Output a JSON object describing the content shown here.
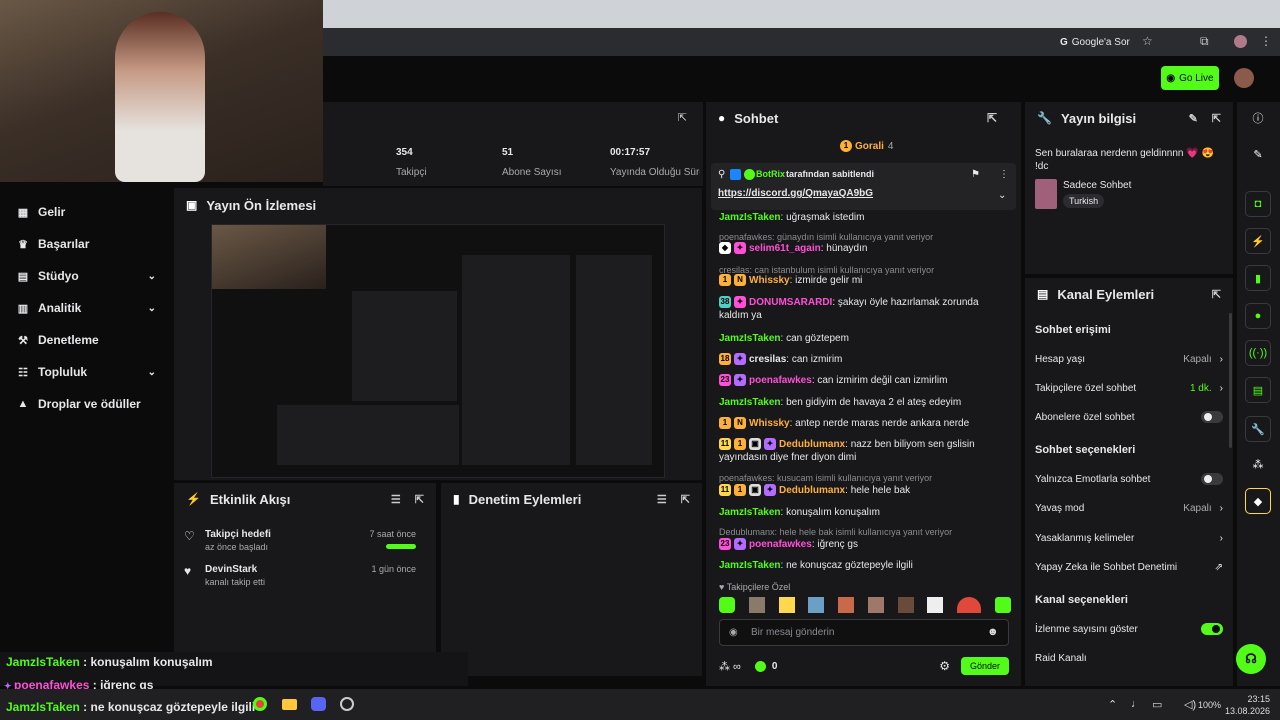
{
  "browser": {
    "google_ask": "Google'a Sor",
    "star_icon": "star-icon"
  },
  "header": {
    "go_live": "Go Live"
  },
  "stats": [
    {
      "value": "354",
      "label": "Takipçi"
    },
    {
      "value": "51",
      "label": "Abone Sayısı"
    },
    {
      "value": "00:17:57",
      "label": "Yayında Olduğu Süre"
    }
  ],
  "sidebar": {
    "items": [
      {
        "label": "Gelir",
        "icon": "dollar-icon",
        "chevron": false
      },
      {
        "label": "Başarılar",
        "icon": "trophy-icon",
        "chevron": false
      },
      {
        "label": "Stüdyo",
        "icon": "studio-icon",
        "chevron": true
      },
      {
        "label": "Analitik",
        "icon": "chart-icon",
        "chevron": true
      },
      {
        "label": "Denetleme",
        "icon": "hammer-icon",
        "chevron": false
      },
      {
        "label": "Topluluk",
        "icon": "people-icon",
        "chevron": true
      },
      {
        "label": "Droplar ve ödüller",
        "icon": "gift-icon",
        "chevron": false
      }
    ]
  },
  "preview": {
    "title": "Yayın Ön İzlemesi"
  },
  "activity": {
    "title": "Etkinlik Akışı",
    "items": [
      {
        "title": "Takipçi hedefi",
        "sub": "az önce başladı",
        "time": "7 saat önce"
      },
      {
        "title": "DevinStark",
        "sub": "kanalı takip etti",
        "time": "1 gün önce"
      }
    ]
  },
  "mod_actions": {
    "title": "Denetim Eylemleri"
  },
  "chat": {
    "title": "Sohbet",
    "gifter": "Gorali",
    "gifter_count": "4",
    "pinned_by": "BotRix",
    "pinned_suffix": "tarafından sabitlendi",
    "pinned_link": "https://discord.gg/QmayaQA9bG",
    "messages": [
      {
        "user": "JamzIsTaken",
        "text": "uğraşmak istedim",
        "reply": "",
        "color": "#53fc18"
      },
      {
        "user": "selim61t_again",
        "text": "hünaydın",
        "reply": "poenafawkes: günaydın isimli kullanıcıya yanıt veriyor",
        "color": "#ff4fd8"
      },
      {
        "user": "Whissky",
        "text": "izmirde gelir mi",
        "reply": "cresilas: can istanbulum isimli kullanıcıya yanıt veriyor",
        "color": "#ffb03a"
      },
      {
        "user": "DONUMSARARDI",
        "text": "şakayı öyle hazırlamak zorunda kaldım ya",
        "reply": "",
        "color": "#ff4fd8"
      },
      {
        "user": "JamzIsTaken",
        "text": "can göztepem",
        "reply": "",
        "color": "#53fc18"
      },
      {
        "user": "cresilas",
        "text": "can izmirim",
        "reply": "",
        "color": "#e8e8ea"
      },
      {
        "user": "poenafawkes",
        "text": "can izmirim değil can izmirlim",
        "reply": "",
        "color": "#ff4fd8"
      },
      {
        "user": "JamzIsTaken",
        "text": "ben gidiyim de havaya 2 el ateş edeyim",
        "reply": "",
        "color": "#53fc18"
      },
      {
        "user": "Whissky",
        "text": "antep nerde maras nerde ankara nerde",
        "reply": "",
        "color": "#ffb03a"
      },
      {
        "user": "Dedublumanx",
        "text": "nazz ben biliyom sen gslisin yayındasın diye fner diyon dimi",
        "reply": "",
        "color": "#ffb03a"
      },
      {
        "user": "Dedublumanx",
        "text": "hele hele bak",
        "reply": "poenafawkes: kusucam isimli kullanıcıya yanıt veriyor",
        "color": "#ffb03a"
      },
      {
        "user": "JamzIsTaken",
        "text": "konuşalım konuşalım",
        "reply": "",
        "color": "#53fc18"
      },
      {
        "user": "poenafawkes",
        "text": "iğrenç gs",
        "reply": "Dedublumanx: hele hele bak isimli kullanıcıya yanıt veriyor",
        "color": "#ff4fd8"
      },
      {
        "user": "JamzIsTaken",
        "text": "ne konuşcaz göztepeyle ilgili",
        "reply": "",
        "color": "#53fc18"
      }
    ],
    "followers_only": "Takipçilere Özel",
    "placeholder": "Bir mesaj gönderin",
    "count": "0",
    "send": "Gönder"
  },
  "stream_info": {
    "title": "Yayın bilgisi",
    "stream_title": "Sen buralaraa nerdenn geldinnnn 💗 😍 !dc",
    "category": "Sadece Sohbet",
    "tag": "Turkish"
  },
  "channel_actions": {
    "title": "Kanal Eylemleri",
    "chat_access": "Sohbet erişimi",
    "account_age": "Hesap yaşı",
    "account_age_value": "Kapalı",
    "followers_chat": "Takipçilere özel sohbet",
    "followers_chat_value": "1 dk.",
    "subs_chat": "Abonelere özel sohbet",
    "chat_options": "Sohbet seçenekleri",
    "emotes_only": "Yalnızca Emotlarla sohbet",
    "slow_mode": "Yavaş mod",
    "slow_mode_value": "Kapalı",
    "banned_words": "Yasaklanmış kelimeler",
    "ai_mod": "Yapay Zeka ile Sohbet Denetimi",
    "channel_options": "Kanal seçenekleri",
    "view_count": "İzlenme sayısını göster",
    "raid": "Raid Kanalı"
  },
  "overlay_chat": [
    {
      "user": "JamzIsTaken",
      "text": " : konuşalım konuşalım",
      "color": "#53fc18"
    },
    {
      "user": "poenafawkes",
      "text": " : iğrenç gs",
      "color": "#ff4fd8"
    },
    {
      "user": "JamzIsTaken",
      "text": " : ne konuşcaz göztepeyle ilgili",
      "color": "#53fc18"
    }
  ],
  "taskbar": {
    "battery": "100%",
    "time": "23:15",
    "date": "13.08.2026"
  },
  "colors": {
    "accent": "#53fc18",
    "panel": "#18181a",
    "bg": "#0b0b0c"
  }
}
